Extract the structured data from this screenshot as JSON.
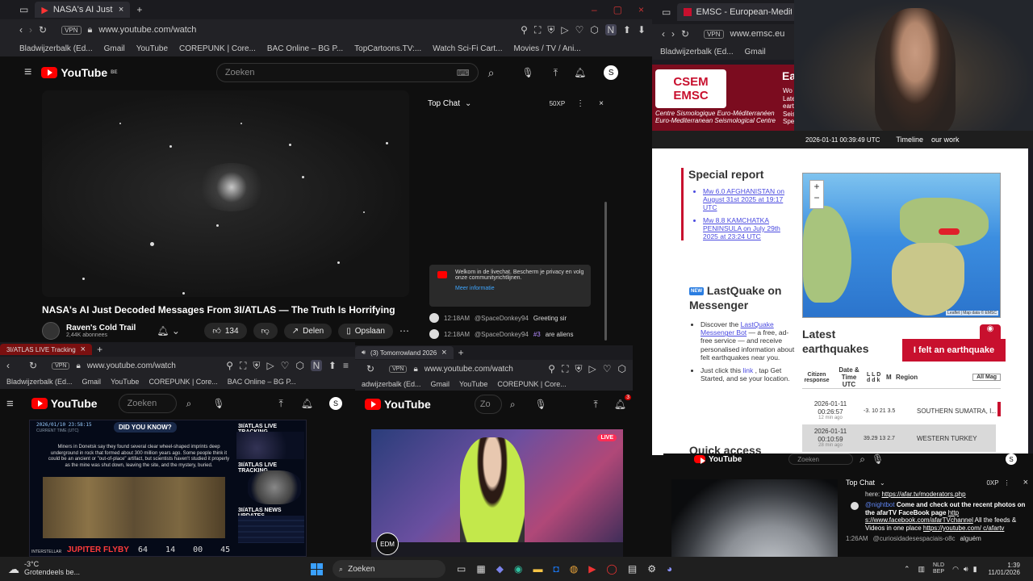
{
  "win1": {
    "tab_title": "NASA's AI Just Decoded",
    "vpn": "VPN",
    "url": "www.youtube.com/watch",
    "bookmarks": [
      "Bladwijzerbalk (Ed...",
      "Gmail",
      "YouTube",
      "COREPUNK | Core...",
      "BAC Online – BG P...",
      "TopCartoons.TV:...",
      "Watch Sci-Fi Cart...",
      "Movies / TV / Ani..."
    ],
    "yt_logo": "YouTube",
    "yt_region": "BE",
    "search_placeholder": "Zoeken",
    "avatar": "S",
    "video_title": "NASA's AI Just Decoded Messages From 3I/ATLAS — The Truth Is Horrifying",
    "channel_name": "Raven's Cold Trail",
    "subscribers": "2,44K abonnees",
    "likes": "134",
    "share_label": "Delen",
    "save_label": "Opslaan",
    "chat_title": "Top Chat",
    "chat_points": "50XP",
    "welcome_text": "Welkom in de livechat. Bescherm je privacy en volg onze communityrichtlijnen.",
    "more_info": "Meer informatie",
    "messages": [
      {
        "time": "12:18AM",
        "user": "@SpaceDonkey94",
        "badge": "",
        "text": "Greeting sir"
      },
      {
        "time": "12:18AM",
        "user": "@SpaceDonkey94",
        "badge": "#3",
        "text": "are aliens"
      }
    ]
  },
  "win2": {
    "tab_title": "3I/ATLAS LIVE Tracking",
    "url": "www.youtube.com/watch",
    "bookmarks": [
      "Bladwijzerbalk (Ed...",
      "Gmail",
      "YouTube",
      "COREPUNK | Core...",
      "BAC Online – BG P..."
    ],
    "yt_logo": "YouTube",
    "search_placeholder": "Zoeken",
    "avatar": "S",
    "overlay_date": "2026/01/10 23:58:15",
    "overlay_current": "CURRENT TIME (UTC)",
    "did_you_know": "DID YOU KNOW?",
    "fact": "Miners in Donetsk say they found several clear wheel-shaped imprints deep underground in rock that formed about 300 million years ago. Some people think it could be an ancient or \"out-of-place\" artifact, but scientists haven't studied it properly as the mine was shut down, leaving the site, and the mystery, buried.",
    "tracking1": "3I/ATLAS LIVE TRACKING",
    "tracking2": "3I/ATLAS LIVE TRACKING",
    "news": "3I/ATLAS NEWS UPDATES",
    "flyby": "JUPITER FLYBY",
    "countdown": [
      "64",
      "14",
      "00",
      "45"
    ],
    "brand": "INTERSTELLAR"
  },
  "win3": {
    "tab_title": "(3) Tomorrowland 2026",
    "url": "www.youtube.com/watch",
    "bookmarks": [
      "adwijzerbalk (Ed...",
      "Gmail",
      "YouTube",
      "COREPUNK | Core..."
    ],
    "yt_logo": "YouTube",
    "search_placeholder": "Zo",
    "notif_count": "3",
    "live_badge": "LIVE",
    "edm_badge": "EDM"
  },
  "win4": {
    "tab_title": "EMSC - European-Mediter",
    "url": "www.emsc.eu",
    "bookmarks": [
      "Bladwijzerbalk (Ed...",
      "Gmail"
    ],
    "logo_csem": "CSEM",
    "logo_emsc": "EMSC",
    "org_fr": "Centre Sismologique Euro-Méditerranéen",
    "org_en": "Euro-Mediterranean Seismological Centre",
    "header_title": "Ea",
    "header_snippet": [
      "Wo",
      "Late",
      "eart",
      "Seis",
      "Spe"
    ],
    "datetime": "2026-01-11 00:39:49 UTC",
    "nav": [
      "Timeline",
      "our work"
    ],
    "special_report": "Special report",
    "reports": [
      "Mw 6.0 AFGHANISTAN on August 31st 2025 at 19:17 UTC",
      "Mw 8.8 KAMCHATKA PENINSULA on July 29th 2025 at 23:24 UTC"
    ],
    "map_attrib": "Leaflet | Map data © EMSC",
    "lastquake_badge": "NEW",
    "lastquake_title": "LastQuake on Messenger",
    "lq_item1_a": "Discover the",
    "lq_item1_link": "LastQuake Messenger Bot",
    "lq_item1_b": "— a free, ad-free service — and receive personalised information about felt earthquakes near you.",
    "lq_item2_a": "Just click this",
    "lq_item2_link": "link",
    "lq_item2_b": ", tap Get Started, and se your location.",
    "latest_title": "Latest earthquakes",
    "felt_button": "I felt an earthquake",
    "col_citizen": "Citizen response",
    "col_datetime": "Date & Time UTC",
    "col_lld": "L L D d d k",
    "col_mag": "M",
    "col_region": "Region",
    "filter": "All Mag",
    "quakes": [
      {
        "date": "2026-01-11",
        "time": "00:26:57",
        "ago": "12 min ago",
        "vals": "-3. 10 21 3.5",
        "region": "SOUTHERN SUMATRA, I..."
      },
      {
        "date": "2026-01-11",
        "time": "00:10:59",
        "ago": "28 min ago",
        "vals": "39.29 13 2.7",
        "region": "WESTERN TURKEY"
      }
    ],
    "quick_access": "Quick access"
  },
  "win5": {
    "yt_logo": "YouTube",
    "search_placeholder": "Zoeken",
    "avatar": "S",
    "chat_title": "Top Chat",
    "chat_points": "0XP",
    "line1_pre": "here:",
    "line1_link": "https://afar.tv/moderators.php",
    "msg_user1": "@nightbot",
    "msg_text1": "Come and check out the recent photos on the afarTV FaceBook page",
    "msg_link1": "http s://www.facebook.com/afarTVchannel",
    "msg_text1b": "All the feeds & Videos in one place",
    "msg_link1b": "https://youtube.com/ c/afartv",
    "msg_time2": "1:26AM",
    "msg_user2": "@curiosidadesespaciais-o8c",
    "msg_text2": "alguém"
  },
  "taskbar": {
    "temp": "-3°C",
    "weather": "Grotendeels be...",
    "search": "Zoeken",
    "lang1": "NLD",
    "lang2": "BEP",
    "time": "1:39",
    "date": "11/01/2026"
  },
  "colors": {
    "yt_red": "#ff0000",
    "emsc_red": "#c8102e",
    "link": "#4a4ae0"
  }
}
